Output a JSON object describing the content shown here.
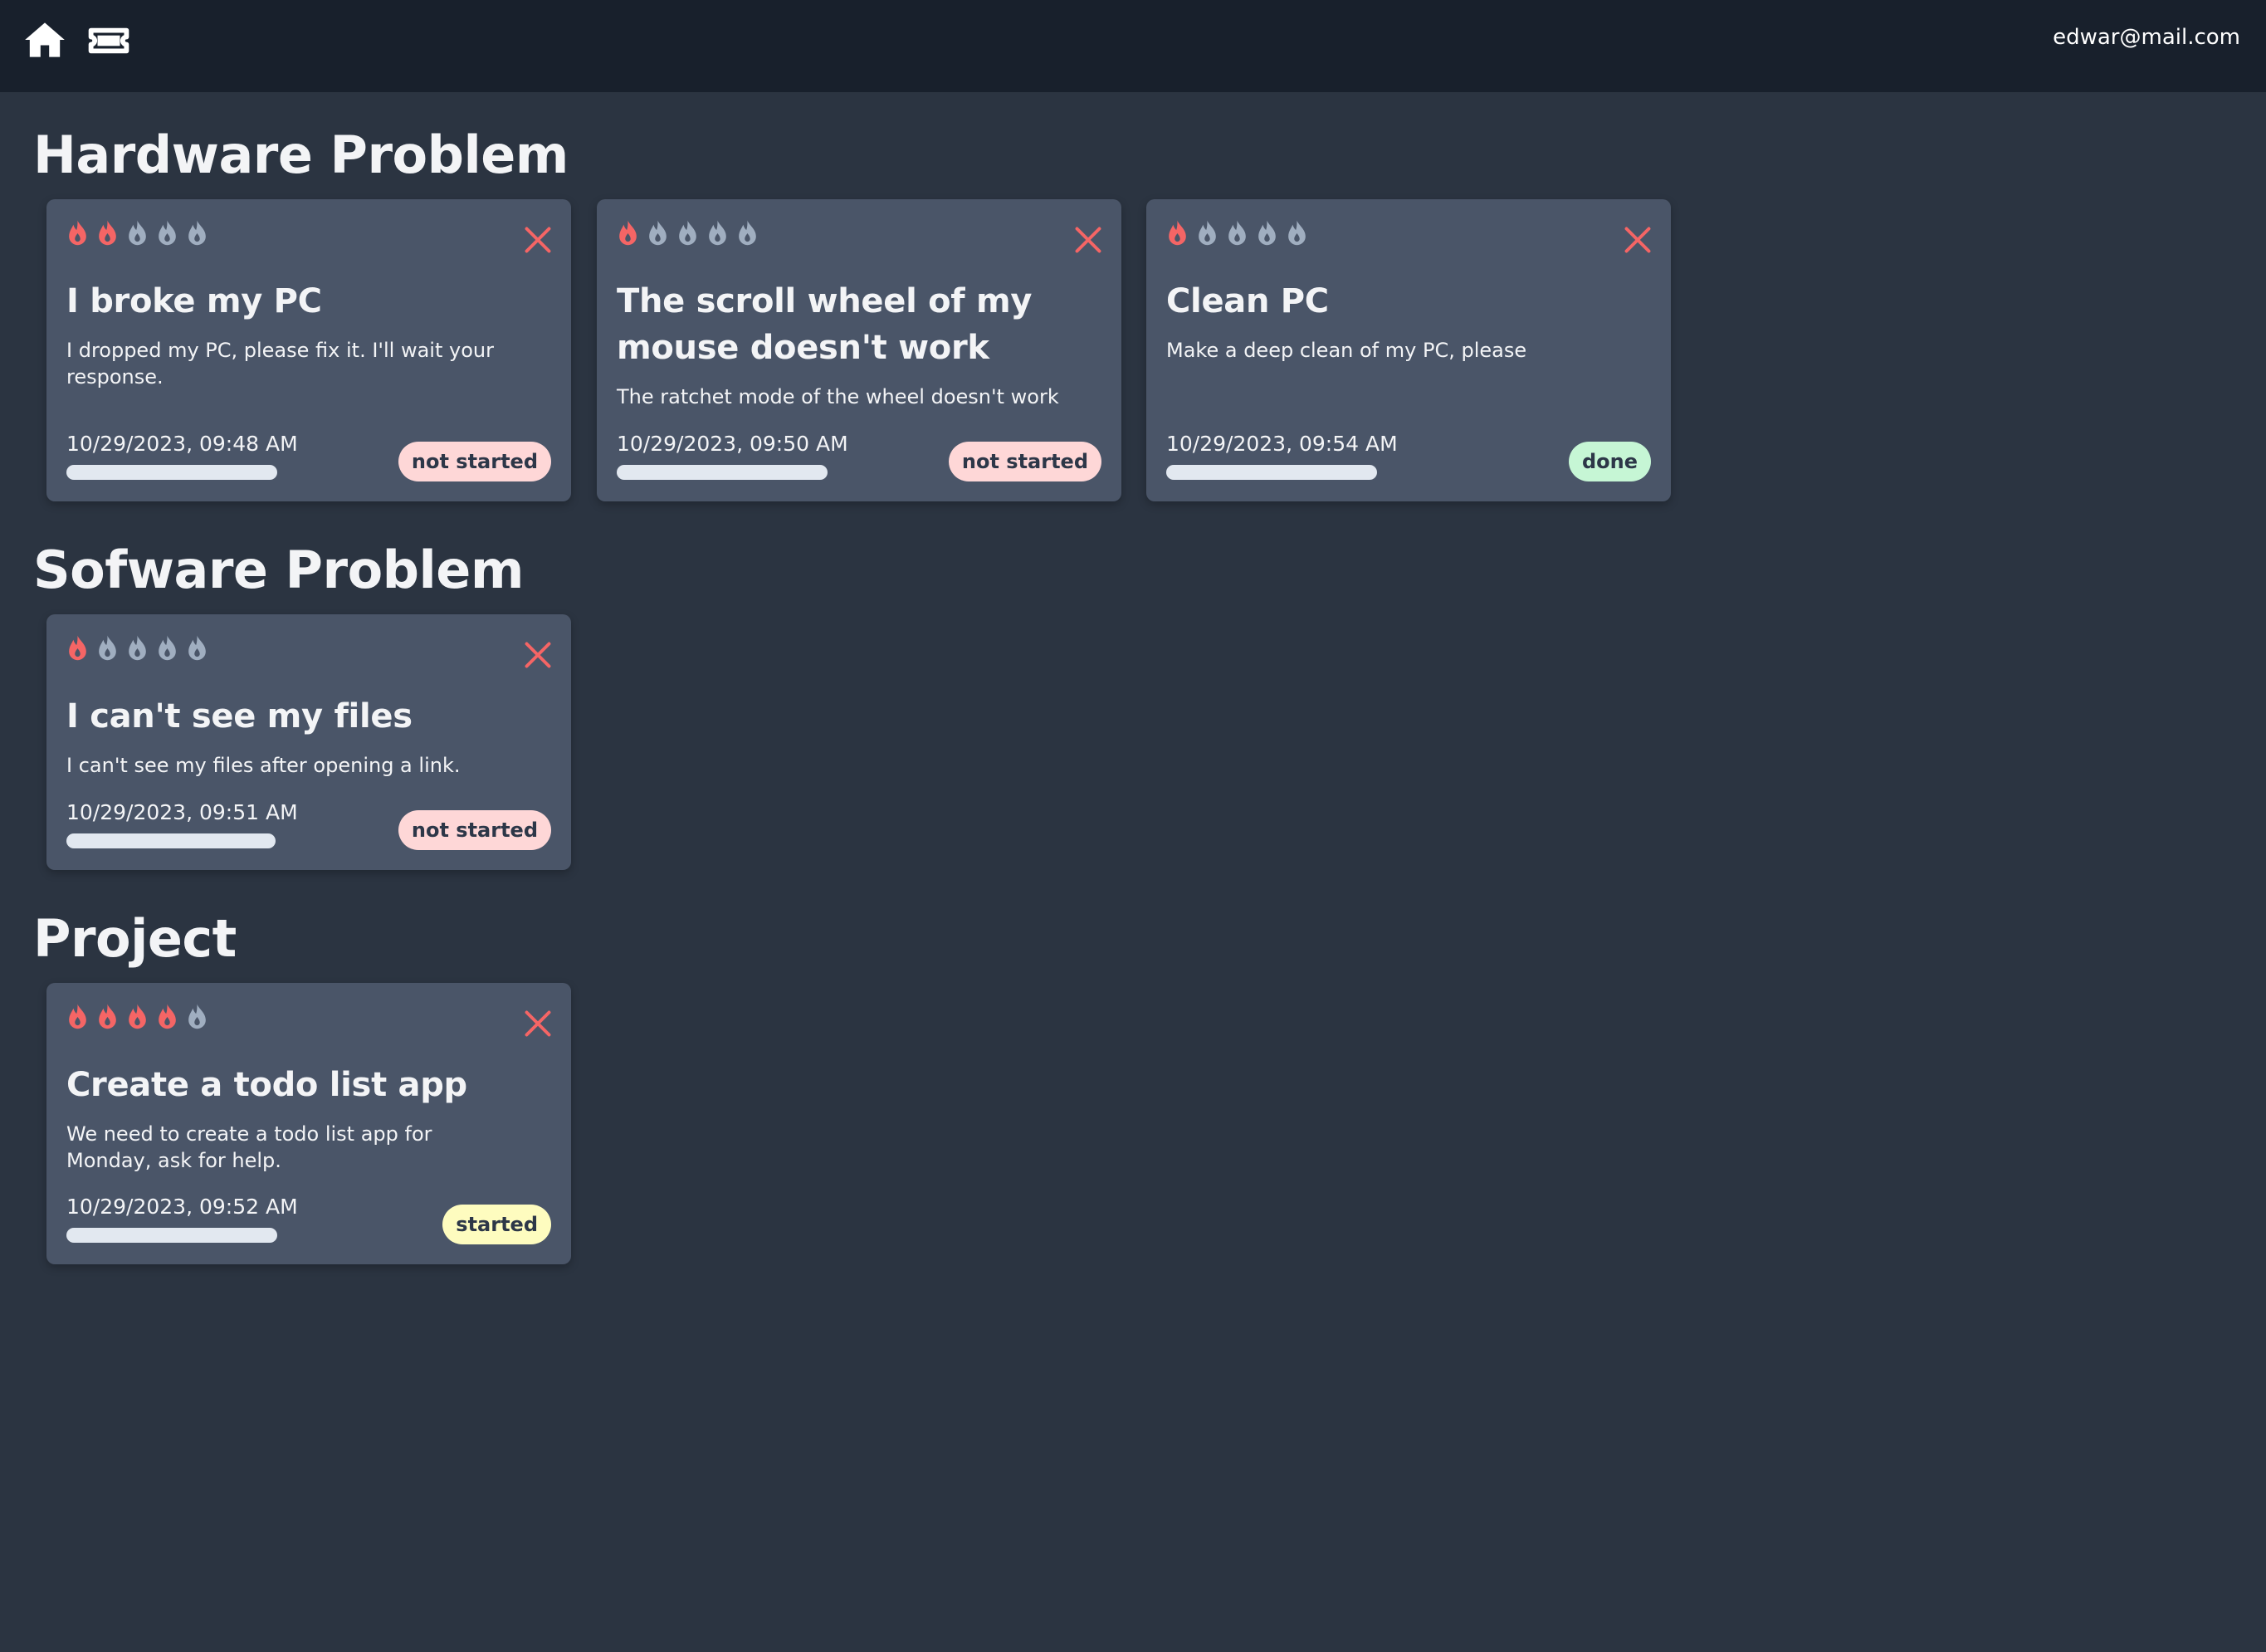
{
  "topbar": {
    "home_icon": "home-icon",
    "tickets_icon": "ticket-icon",
    "user_email": "edwar@mail.com"
  },
  "colors": {
    "page_bg": "#2b3441",
    "topbar_bg": "#18202c",
    "card_bg": "#4a5568",
    "flame_active": "#f56565",
    "flame_inactive": "#a0aec0",
    "close": "#f56565",
    "badge_not_started": "#fed7d7",
    "badge_done": "#c6f6d5",
    "badge_started": "#fefcbf"
  },
  "sections": [
    {
      "title": "Hardware Problem",
      "cards": [
        {
          "priority": 2,
          "priority_max": 5,
          "title": "I broke my PC",
          "description": "I dropped my PC, please fix it. I'll wait your response.",
          "date": "10/29/2023, 09:48 AM",
          "status": "not started",
          "progress": 0
        },
        {
          "priority": 1,
          "priority_max": 5,
          "title": "The scroll wheel of my mouse doesn't work",
          "description": "The ratchet mode of the wheel doesn't work",
          "date": "10/29/2023, 09:50 AM",
          "status": "not started",
          "progress": 0
        },
        {
          "priority": 1,
          "priority_max": 5,
          "title": "Clean PC",
          "description": "Make a deep clean of my PC, please",
          "date": "10/29/2023, 09:54 AM",
          "status": "done",
          "progress": 0
        }
      ]
    },
    {
      "title": "Sofware Problem",
      "cards": [
        {
          "priority": 1,
          "priority_max": 5,
          "title": "I can't see my files",
          "description": "I can't see my files after opening a link.",
          "date": "10/29/2023, 09:51 AM",
          "status": "not started",
          "progress": 0
        }
      ]
    },
    {
      "title": "Project",
      "cards": [
        {
          "priority": 4,
          "priority_max": 5,
          "title": "Create a todo list app",
          "description": "We need to create a todo list app for Monday, ask for help.",
          "date": "10/29/2023, 09:52 AM",
          "status": "started",
          "progress": 0
        }
      ]
    }
  ]
}
